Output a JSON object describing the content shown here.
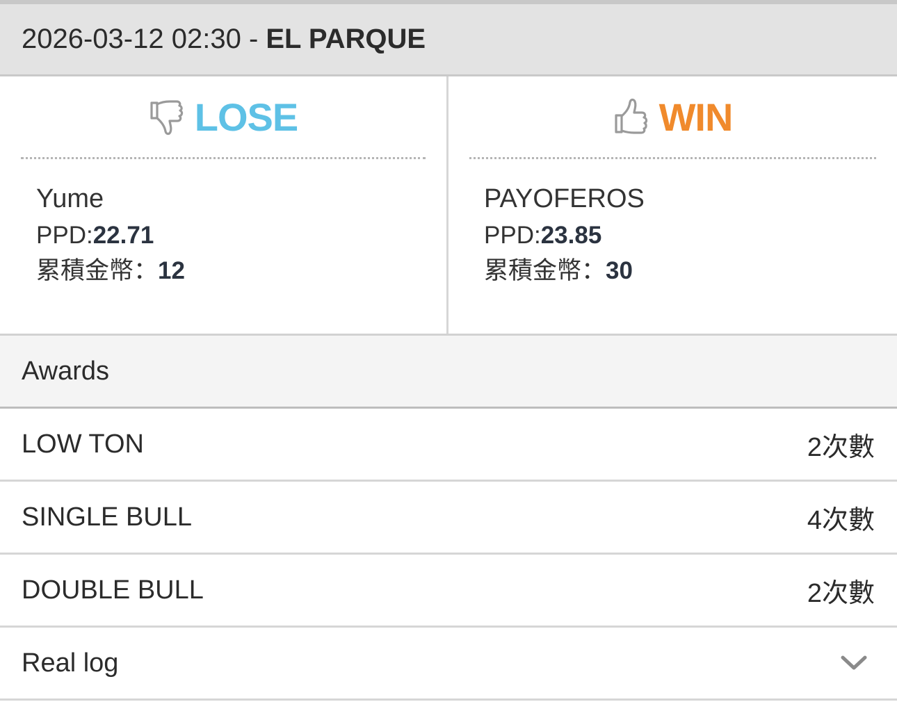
{
  "header": {
    "datetime": "2026-03-12 02:30",
    "separator": " - ",
    "venue": "EL PARQUE"
  },
  "players": [
    {
      "result": "LOSE",
      "result_icon": "thumbs-down-icon",
      "result_color": "#5ec1e6",
      "name": "Yume",
      "ppd_label": "PPD:",
      "ppd_value": "22.71",
      "coins_label": "累積金幣：",
      "coins_value": "12"
    },
    {
      "result": "WIN",
      "result_icon": "thumbs-up-icon",
      "result_color": "#f08a2c",
      "name": "PAYOFEROS",
      "ppd_label": "PPD:",
      "ppd_value": "23.85",
      "coins_label": "累積金幣：",
      "coins_value": "30"
    }
  ],
  "awards": {
    "title": "Awards",
    "items": [
      {
        "name": "LOW TON",
        "count": "2次數"
      },
      {
        "name": "SINGLE BULL",
        "count": "4次數"
      },
      {
        "name": "DOUBLE BULL",
        "count": "2次數"
      }
    ]
  },
  "real_log": {
    "label": "Real log",
    "icon": "chevron-down-icon"
  }
}
